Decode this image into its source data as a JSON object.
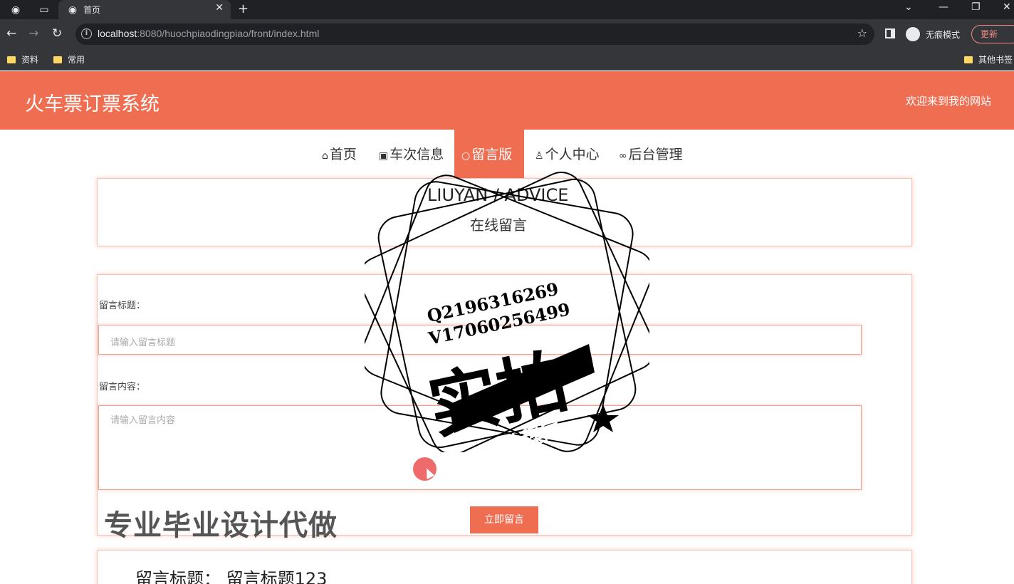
{
  "browser": {
    "tab_title": "首页",
    "url_host": "localhost",
    "url_rest": ":8080/huochpiaodingpiao/front/index.html",
    "incognito_label": "无痕模式",
    "update_label": "更新",
    "bookmarks": [
      "资料",
      "常用"
    ],
    "other_bookmarks": "其他书签"
  },
  "site": {
    "title": "火车票订票系统",
    "welcome": "欢迎来到我的网站"
  },
  "nav": [
    {
      "label": "首页",
      "icon": "home-icon"
    },
    {
      "label": "车次信息",
      "icon": "gift-icon"
    },
    {
      "label": "留言版",
      "icon": "circle-icon"
    },
    {
      "label": "个人中心",
      "icon": "user-icon"
    },
    {
      "label": "后台管理",
      "icon": "link-icon"
    }
  ],
  "section": {
    "title": "LIUYAN / ADVICE",
    "subtitle": "在线留言"
  },
  "form": {
    "title_label": "留言标题：",
    "title_placeholder": "请输入留言标题",
    "content_label": "留言内容：",
    "content_placeholder": "请输入留言内容",
    "submit_label": "立即留言"
  },
  "messages": [
    {
      "title": "留言标题：  留言标题123"
    }
  ],
  "watermark": {
    "line1": "Q2196316269",
    "line2": "V17060256499",
    "big": "实拍",
    "ribbon": "全微程序",
    "promo": "专业毕业设计代做"
  },
  "colors": {
    "accent": "#ef6e52"
  }
}
